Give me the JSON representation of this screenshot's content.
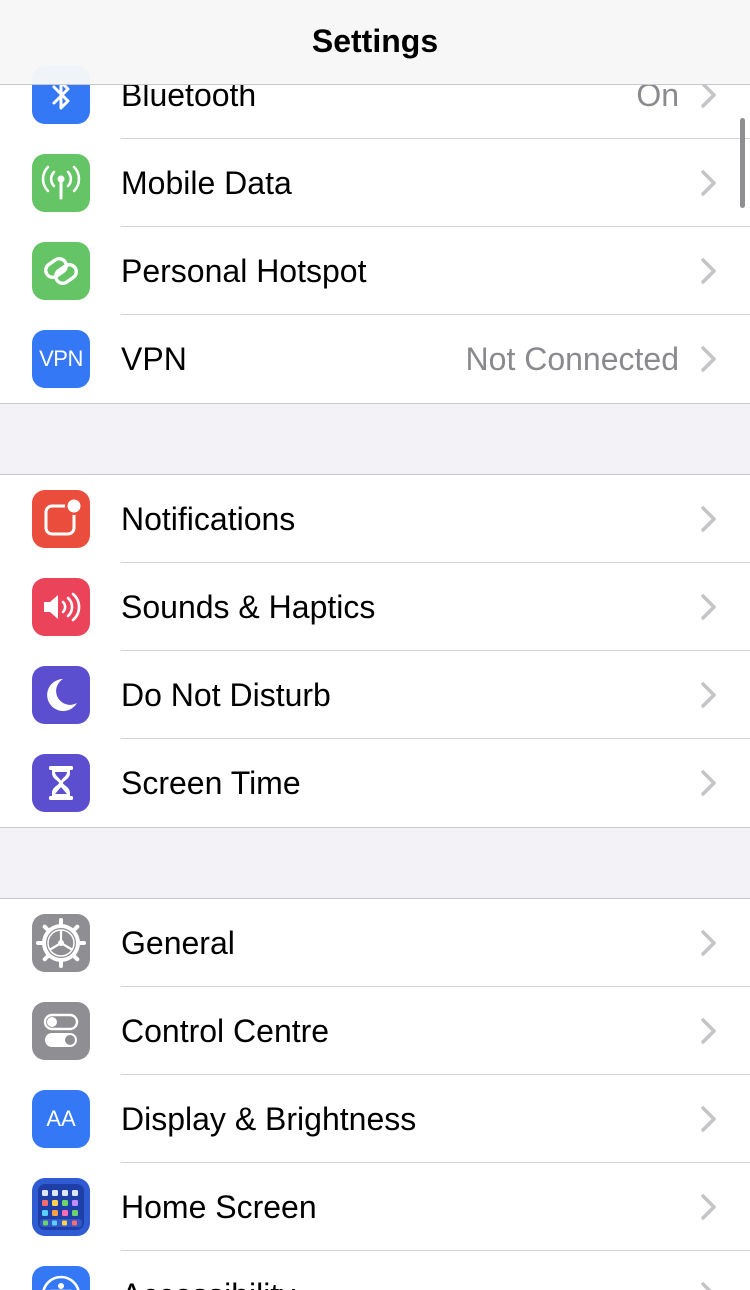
{
  "header": {
    "title": "Settings"
  },
  "groups": [
    {
      "rows": [
        {
          "label": "Bluetooth",
          "value": "On",
          "icon": "bluetooth-icon",
          "color": "#3478f6"
        },
        {
          "label": "Mobile Data",
          "value": "",
          "icon": "antenna-icon",
          "color": "#65c466"
        },
        {
          "label": "Personal Hotspot",
          "value": "",
          "icon": "hotspot-icon",
          "color": "#65c466"
        },
        {
          "label": "VPN",
          "value": "Not Connected",
          "icon": "vpn-icon",
          "icon_text": "VPN",
          "color": "#3478f6"
        }
      ]
    },
    {
      "rows": [
        {
          "label": "Notifications",
          "value": "",
          "icon": "notifications-icon",
          "color": "#eb4d3d"
        },
        {
          "label": "Sounds & Haptics",
          "value": "",
          "icon": "speaker-icon",
          "color": "#eb445a"
        },
        {
          "label": "Do Not Disturb",
          "value": "",
          "icon": "moon-icon",
          "color": "#5b4fcf"
        },
        {
          "label": "Screen Time",
          "value": "",
          "icon": "hourglass-icon",
          "color": "#5b4fcf"
        }
      ]
    },
    {
      "rows": [
        {
          "label": "General",
          "value": "",
          "icon": "gear-icon",
          "color": "#8e8e93"
        },
        {
          "label": "Control Centre",
          "value": "",
          "icon": "toggles-icon",
          "color": "#8e8e93"
        },
        {
          "label": "Display & Brightness",
          "value": "",
          "icon": "text-size-icon",
          "icon_text": "AA",
          "color": "#3478f6"
        },
        {
          "label": "Home Screen",
          "value": "",
          "icon": "home-grid-icon",
          "color": "#2f5bd3"
        },
        {
          "label": "Accessibility",
          "value": "",
          "icon": "accessibility-icon",
          "color": "#3478f6"
        }
      ]
    }
  ]
}
